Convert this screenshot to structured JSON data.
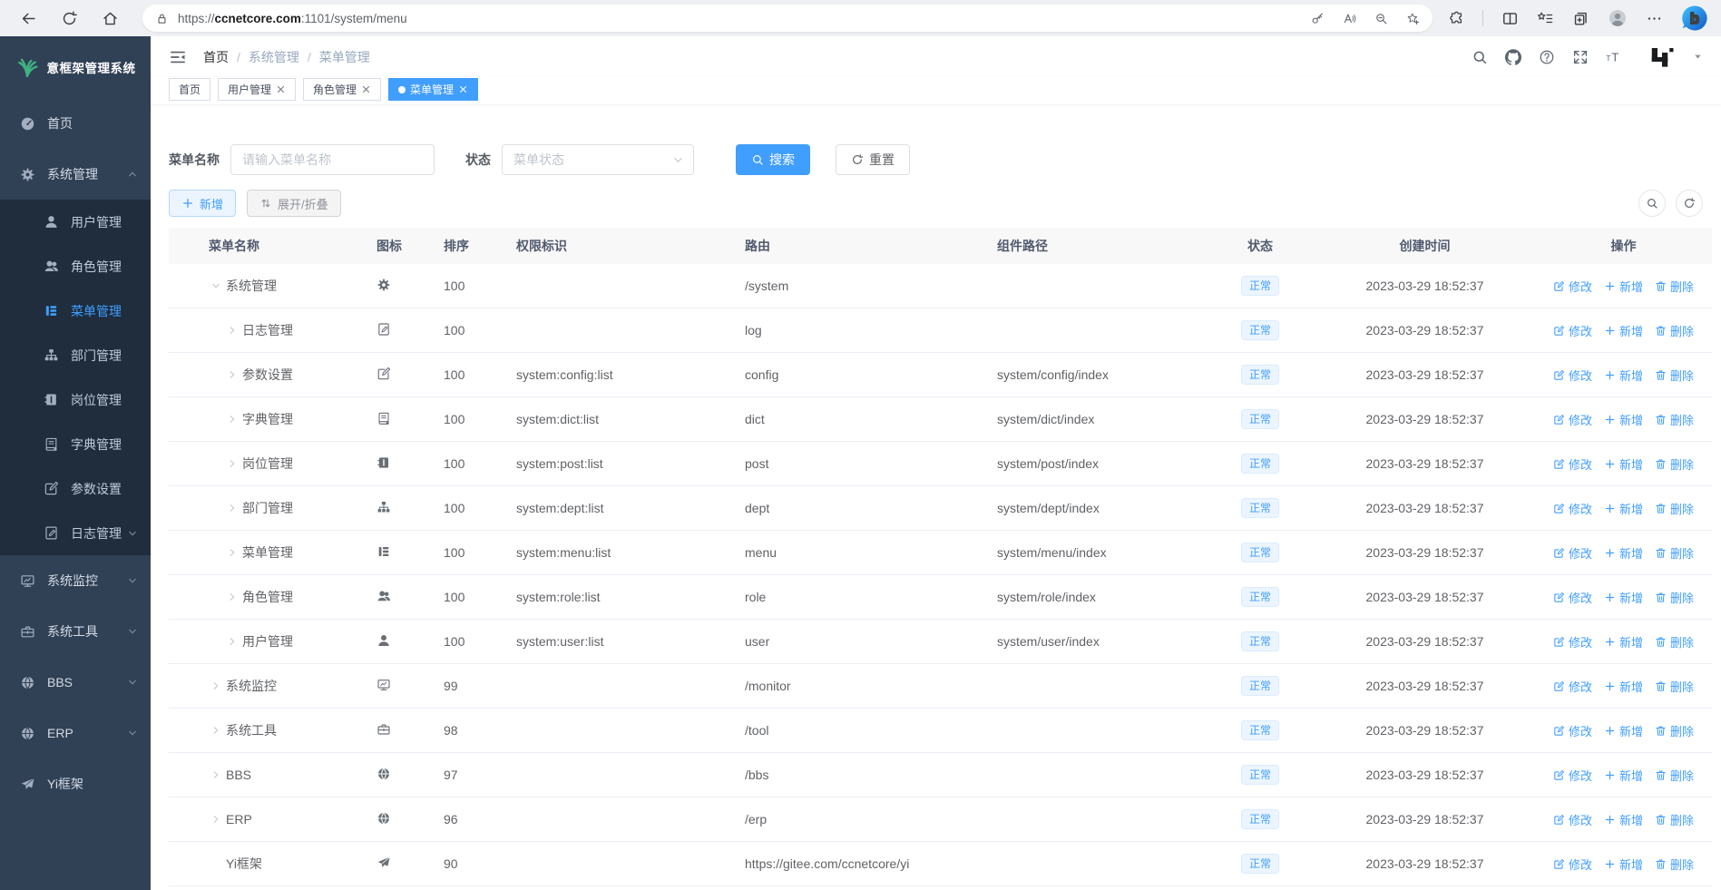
{
  "browser": {
    "url_scheme": "https://",
    "url_host": "ccnetcore.com",
    "url_path": ":1101/system/menu",
    "nav_icons": [
      "back",
      "reload",
      "home"
    ],
    "lock_icon": "lock",
    "pill_icons": [
      "key",
      "readaloud",
      "zoomout",
      "starplus"
    ],
    "right_icons": [
      "puzzle",
      "split",
      "favbar",
      "copyplus",
      "avatar",
      "dots",
      "bing"
    ]
  },
  "sidebar": {
    "title": "意框架管理系统",
    "logo_icon": "leaf",
    "items": [
      {
        "label": "首页",
        "icon": "dashboard"
      },
      {
        "label": "系统管理",
        "icon": "gear",
        "chevron": "chevron-up"
      },
      {
        "label": "用户管理",
        "icon": "user"
      },
      {
        "label": "角色管理",
        "icon": "users"
      },
      {
        "label": "菜单管理",
        "icon": "menu"
      },
      {
        "label": "部门管理",
        "icon": "tree"
      },
      {
        "label": "岗位管理",
        "icon": "badge"
      },
      {
        "label": "字典管理",
        "icon": "book"
      },
      {
        "label": "参数设置",
        "icon": "edit"
      },
      {
        "label": "日志管理",
        "icon": "log",
        "chevron": "chevron-down"
      },
      {
        "label": "系统监控",
        "icon": "monitor",
        "chevron": "chevron-down"
      },
      {
        "label": "系统工具",
        "icon": "tool",
        "chevron": "chevron-down"
      },
      {
        "label": "BBS",
        "icon": "globe",
        "chevron": "chevron-down"
      },
      {
        "label": "ERP",
        "icon": "globe",
        "chevron": "chevron-down"
      },
      {
        "label": "Yi框架",
        "icon": "plane"
      }
    ]
  },
  "header": {
    "fold_icon": "fold",
    "breadcrumb": [
      "首页",
      "系统管理",
      "菜单管理"
    ],
    "separator": "/",
    "icons": [
      "search",
      "github",
      "question",
      "fullscreen",
      "fontsize"
    ],
    "logo_icon": "yilogo",
    "caret_icon": "caret"
  },
  "tabs": [
    {
      "label": "首页",
      "closable": false,
      "active": false
    },
    {
      "label": "用户管理",
      "closable": true,
      "active": false
    },
    {
      "label": "角色管理",
      "closable": true,
      "active": false
    },
    {
      "label": "菜单管理",
      "closable": true,
      "active": true
    }
  ],
  "filters": {
    "name_label": "菜单名称",
    "name_placeholder": "请输入菜单名称",
    "status_label": "状态",
    "status_placeholder": "菜单状态",
    "search_label": "搜索",
    "reset_label": "重置"
  },
  "toolbar": {
    "add_label": "新增",
    "expand_label": "展开/折叠",
    "icons": [
      "search",
      "refresh"
    ]
  },
  "table": {
    "columns": [
      "菜单名称",
      "图标",
      "排序",
      "权限标识",
      "路由",
      "组件路径",
      "状态",
      "创建时间",
      "操作"
    ],
    "status_normal": "正常",
    "created_at": "2023-03-29 18:52:37",
    "actions": {
      "edit": "修改",
      "add": "新增",
      "delete": "删除"
    },
    "rows": [
      {
        "name": "系统管理",
        "arrow": "down",
        "indent": 0,
        "icon": "gear",
        "sort": "100",
        "perm": "",
        "route": "/system",
        "component": ""
      },
      {
        "name": "日志管理",
        "arrow": "right",
        "indent": 1,
        "icon": "log",
        "sort": "100",
        "perm": "",
        "route": "log",
        "component": ""
      },
      {
        "name": "参数设置",
        "arrow": "right",
        "indent": 1,
        "icon": "edit",
        "sort": "100",
        "perm": "system:config:list",
        "route": "config",
        "component": "system/config/index"
      },
      {
        "name": "字典管理",
        "arrow": "right",
        "indent": 1,
        "icon": "book",
        "sort": "100",
        "perm": "system:dict:list",
        "route": "dict",
        "component": "system/dict/index"
      },
      {
        "name": "岗位管理",
        "arrow": "right",
        "indent": 1,
        "icon": "badge",
        "sort": "100",
        "perm": "system:post:list",
        "route": "post",
        "component": "system/post/index"
      },
      {
        "name": "部门管理",
        "arrow": "right",
        "indent": 1,
        "icon": "tree",
        "sort": "100",
        "perm": "system:dept:list",
        "route": "dept",
        "component": "system/dept/index"
      },
      {
        "name": "菜单管理",
        "arrow": "right",
        "indent": 1,
        "icon": "menu",
        "sort": "100",
        "perm": "system:menu:list",
        "route": "menu",
        "component": "system/menu/index"
      },
      {
        "name": "角色管理",
        "arrow": "right",
        "indent": 1,
        "icon": "users",
        "sort": "100",
        "perm": "system:role:list",
        "route": "role",
        "component": "system/role/index"
      },
      {
        "name": "用户管理",
        "arrow": "right",
        "indent": 1,
        "icon": "user",
        "sort": "100",
        "perm": "system:user:list",
        "route": "user",
        "component": "system/user/index"
      },
      {
        "name": "系统监控",
        "arrow": "right",
        "indent": 0,
        "icon": "monitor",
        "sort": "99",
        "perm": "",
        "route": "/monitor",
        "component": ""
      },
      {
        "name": "系统工具",
        "arrow": "right",
        "indent": 0,
        "icon": "tool",
        "sort": "98",
        "perm": "",
        "route": "/tool",
        "component": ""
      },
      {
        "name": "BBS",
        "arrow": "right",
        "indent": 0,
        "icon": "globe",
        "sort": "97",
        "perm": "",
        "route": "/bbs",
        "component": ""
      },
      {
        "name": "ERP",
        "arrow": "right",
        "indent": 0,
        "icon": "globe",
        "sort": "96",
        "perm": "",
        "route": "/erp",
        "component": ""
      },
      {
        "name": "Yi框架",
        "arrow": "none",
        "indent": 0,
        "icon": "plane",
        "sort": "90",
        "perm": "",
        "route": "https://gitee.com/ccnetcore/yi",
        "component": ""
      }
    ]
  },
  "colors": {
    "accent": "#409eff",
    "sidebar_bg": "#304156",
    "sidebar_sub_bg": "#1f2d3d",
    "badge_bg": "#ecf5ff",
    "logo_green": "#3eb27f"
  }
}
